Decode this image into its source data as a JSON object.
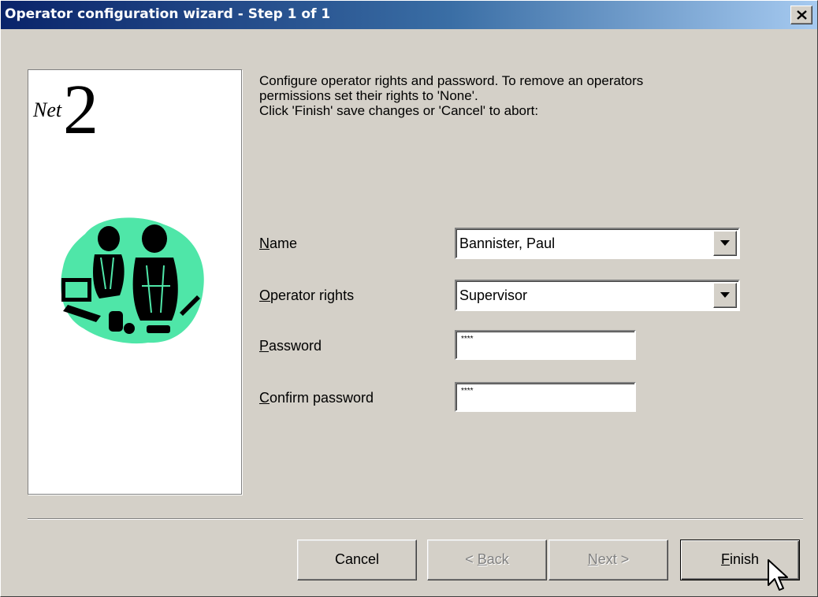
{
  "window": {
    "title": "Operator configuration wizard - Step 1 of 1"
  },
  "logo": {
    "net": "Net",
    "two": "2"
  },
  "instructions": {
    "line1": "Configure operator rights and password. To remove an operators",
    "line2": "permissions set their rights to 'None'.",
    "line3": "Click 'Finish' save changes or 'Cancel' to abort:"
  },
  "form": {
    "name": {
      "label_access": "N",
      "label_rest": "ame",
      "value": "Bannister, Paul"
    },
    "rights": {
      "label_access": "O",
      "label_rest": "perator rights",
      "value": "Supervisor"
    },
    "password": {
      "label_access": "P",
      "label_rest": "assword",
      "value": "****"
    },
    "confirm": {
      "label_access": "C",
      "label_rest": "onfirm password",
      "value": "****"
    }
  },
  "buttons": {
    "cancel": "Cancel",
    "back_prefix": "< ",
    "back_access": "B",
    "back_rest": "ack",
    "next_access": "N",
    "next_rest": "ext >",
    "finish_access": "F",
    "finish_rest": "inish"
  },
  "colors": {
    "titlebar_start": "#0a246a",
    "titlebar_end": "#a6caf0",
    "face": "#d4d0c8",
    "clipart_blob": "#4fe6a8"
  },
  "icons": {
    "close": "close-icon",
    "dropdown": "chevron-down-icon",
    "cursor": "mouse-pointer-icon"
  }
}
